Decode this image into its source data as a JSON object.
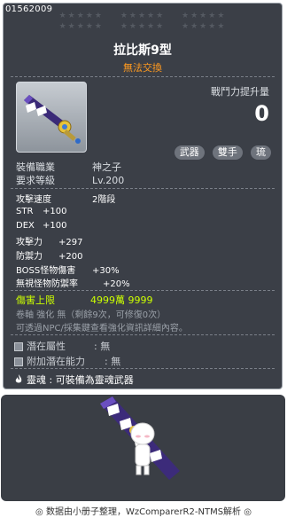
{
  "tooltip": {
    "item_id": "01562009",
    "stars_row1": [
      "★★★★★",
      "★★★★★",
      "★★★★★"
    ],
    "stars_row2": [
      "★★★★★",
      "★★★★★",
      "★★★★★"
    ],
    "title": "拉比斯9型",
    "subtitle": "無法交換",
    "power_label": "戰鬥力提升量",
    "power_value": "0",
    "tags": [
      "武器",
      "雙手",
      "琉"
    ],
    "requirements": [
      {
        "label": "裝備職業",
        "value": "神之子"
      },
      {
        "label": "要求等級",
        "value": "Lv.200"
      }
    ],
    "stats": [
      {
        "label": "攻擊速度",
        "value": "2階段"
      },
      {
        "label": "STR",
        "value": "+100"
      },
      {
        "label": "DEX",
        "value": "+100"
      },
      {
        "label": "攻擊力",
        "value": "+297"
      },
      {
        "label": "防禦力",
        "value": "+200"
      },
      {
        "label": "BOSS怪物傷害",
        "value": "+30%"
      },
      {
        "label": "無視怪物防禦率",
        "value": "+20%"
      }
    ],
    "damage_cap": {
      "label": "傷害上限",
      "value": "4999萬 9999"
    },
    "scroll_line": "卷軸 強化 無（剩餘9次，可修復0次）",
    "npc_line": "可透過NPC/採集鍵查看強化資訊詳細內容。",
    "potential": {
      "label": "潛在屬性",
      "value": "無"
    },
    "bonus_potential": {
      "label": "附加潛在能力",
      "value": "無"
    },
    "soul": "靈魂 : 可裝備為靈魂武器",
    "colors": {
      "damage_cap": "#ccff00",
      "subtitle": "#ff9a1f",
      "background": "#3b3f47"
    }
  },
  "preview": {
    "icon": "character-with-sword-icon"
  },
  "footer": "◎ 数据由小册子整理，WzComparerR2-NTMS解析 ◎"
}
